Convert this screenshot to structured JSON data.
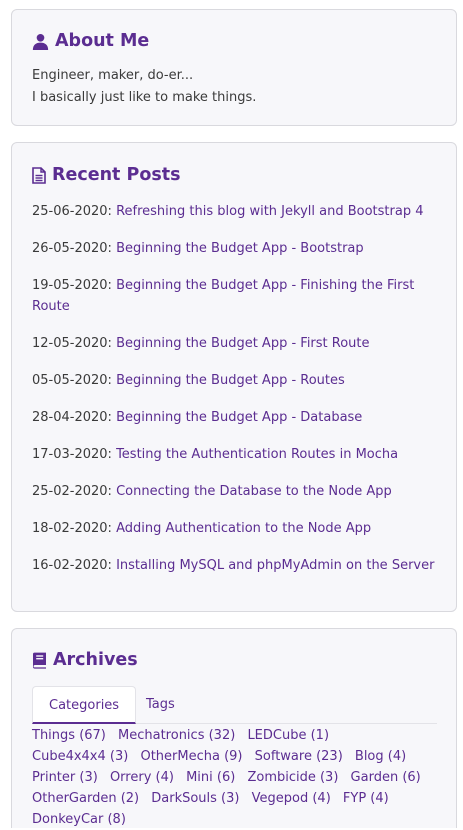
{
  "about": {
    "title": "About Me",
    "line1": "Engineer, maker, do-er...",
    "line2": "I basically just like to make things."
  },
  "posts": {
    "title": "Recent Posts",
    "items": [
      {
        "date": "25-06-2020:",
        "title": "Refreshing this blog with Jekyll and Bootstrap 4"
      },
      {
        "date": "26-05-2020:",
        "title": "Beginning the Budget App - Bootstrap"
      },
      {
        "date": "19-05-2020:",
        "title": "Beginning the Budget App - Finishing the First Route"
      },
      {
        "date": "12-05-2020:",
        "title": "Beginning the Budget App - First Route"
      },
      {
        "date": "05-05-2020:",
        "title": "Beginning the Budget App - Routes"
      },
      {
        "date": "28-04-2020:",
        "title": "Beginning the Budget App - Database"
      },
      {
        "date": "17-03-2020:",
        "title": "Testing the Authentication Routes in Mocha"
      },
      {
        "date": "25-02-2020:",
        "title": "Connecting the Database to the Node App"
      },
      {
        "date": "18-02-2020:",
        "title": "Adding Authentication to the Node App"
      },
      {
        "date": "16-02-2020:",
        "title": "Installing MySQL and phpMyAdmin on the Server"
      }
    ]
  },
  "archives": {
    "title": "Archives",
    "tabs": [
      "Categories",
      "Tags"
    ],
    "categories": [
      "Things (67)",
      "Mechatronics (32)",
      "LEDCube (1)",
      "Cube4x4x4 (3)",
      "OtherMecha (9)",
      "Software (23)",
      "Blog (4)",
      "Printer (3)",
      "Orrery (4)",
      "Mini (6)",
      "Zombicide (3)",
      "Garden (6)",
      "OtherGarden (2)",
      "DarkSouls (3)",
      "Vegepod (4)",
      "FYP (4)",
      "DonkeyCar (8)"
    ]
  },
  "colors": {
    "accent": "#5b2d91",
    "text": "#3a3a3a",
    "card_bg": "#f7f7fa",
    "border": "#d9d9de"
  },
  "icons": {
    "about": "user-icon",
    "posts": "file-text-icon",
    "archives": "book-icon"
  }
}
